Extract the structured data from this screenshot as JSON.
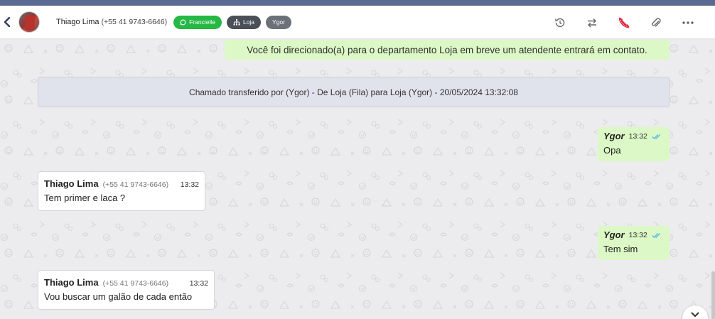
{
  "header": {
    "contact_name": "Thiago Lima",
    "contact_phone": "(+55 41 9743-6646)",
    "tags": [
      {
        "label": "Francielle",
        "icon": "whatsapp-icon",
        "color": "#25b845"
      },
      {
        "label": "Loja",
        "icon": "sitemap-icon",
        "color": "#4a4f58"
      },
      {
        "label": "Ygor",
        "icon": "",
        "color": "#6b7079"
      }
    ],
    "actions": [
      "history-icon",
      "transfer-icon",
      "hangup-phone-icon",
      "paperclip-icon",
      "more-icon"
    ]
  },
  "chat": {
    "system_message": "Você foi direcionado(a) para o departamento Loja em breve um atendente entrará em contato.",
    "transfer_notice": "Chamado transferido por (Ygor) - De Loja (Fila) para Loja (Ygor) - 20/05/2024 13:32:08",
    "messages": [
      {
        "direction": "out",
        "sender": "Ygor",
        "time": "13:32",
        "text": "Opa",
        "status": "read"
      },
      {
        "direction": "in",
        "sender": "Thiago Lima",
        "phone": "(+55 41 9743-6646)",
        "time": "13:32",
        "text": "Tem primer e laca ?"
      },
      {
        "direction": "out",
        "sender": "Ygor",
        "time": "13:32",
        "text": "Tem sim",
        "status": "read"
      },
      {
        "direction": "in",
        "sender": "Thiago Lima",
        "phone": "(+55 41 9743-6646)",
        "time": "13:32",
        "text": "Vou buscar um galão de cada então"
      }
    ]
  },
  "colors": {
    "outgoing_bubble": "#dcf8c6",
    "incoming_bubble": "#ffffff",
    "read_ticks": "#4fb6ec",
    "hangup": "#e0243c",
    "topbar": "#5a6a92"
  }
}
